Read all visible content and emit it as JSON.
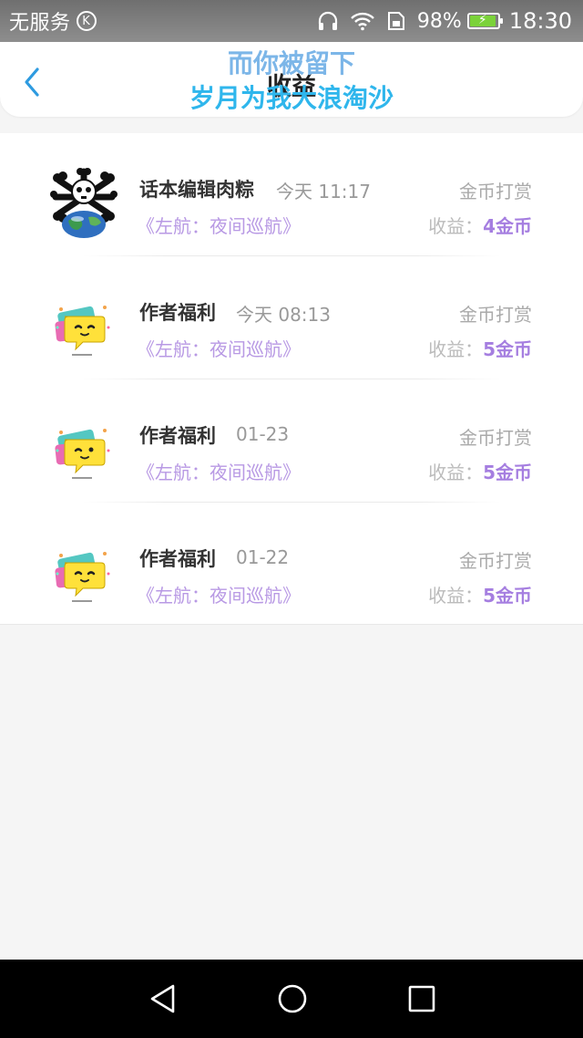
{
  "status_bar": {
    "carrier": "无服务",
    "k_badge": "K",
    "battery_percent": "98%",
    "time": "18:30",
    "battery_level": 0.98,
    "icons": [
      "headphones-icon",
      "wifi-icon",
      "sim-icon",
      "battery-icon"
    ]
  },
  "header": {
    "title": "收益",
    "overlay_line1": "而你被留下",
    "overlay_line2": "岁月为我大浪淘沙",
    "back_icon": "chevron-left-icon",
    "accent_color": "#2e9be0"
  },
  "records": [
    {
      "name": "话本编辑肉粽",
      "time": "今天 11:17",
      "type": "金币打赏",
      "book": "《左航：夜间巡航》",
      "earn_label": "收益：",
      "earn_value": "4金币",
      "avatar": "globe-skull-avatar"
    },
    {
      "name": "作者福利",
      "time": "今天 08:13",
      "type": "金币打赏",
      "book": "《左航：夜间巡航》",
      "earn_label": "收益：",
      "earn_value": "5金币",
      "avatar": "yellow-chat-bubble-avatar"
    },
    {
      "name": "作者福利",
      "time": "01-23",
      "type": "金币打赏",
      "book": "《左航：夜间巡航》",
      "earn_label": "收益：",
      "earn_value": "5金币",
      "avatar": "yellow-chat-bubble-avatar"
    },
    {
      "name": "作者福利",
      "time": "01-22",
      "type": "金币打赏",
      "book": "《左航：夜间巡航》",
      "earn_label": "收益：",
      "earn_value": "5金币",
      "avatar": "yellow-chat-bubble-avatar"
    }
  ],
  "nav_bar": {
    "icons": [
      "back-triangle-icon",
      "home-circle-icon",
      "recents-square-icon"
    ]
  }
}
